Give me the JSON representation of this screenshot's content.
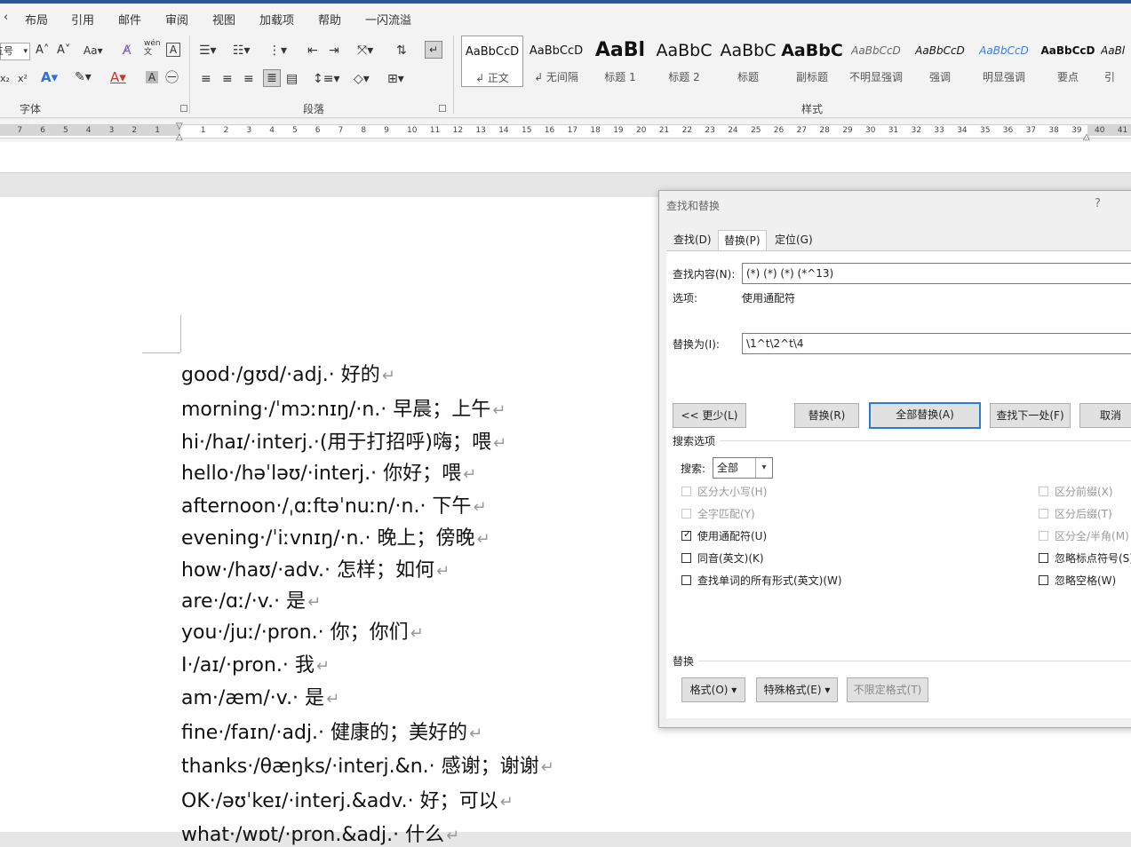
{
  "menu": [
    "布局",
    "引用",
    "邮件",
    "审阅",
    "视图",
    "加载项",
    "帮助",
    "一闪流溢"
  ],
  "ribbon": {
    "font_group_label": "字体",
    "paragraph_group_label": "段落",
    "styles_group_label": "样式",
    "font_size_partial": "五号",
    "styles": [
      {
        "preview": "AaBbCcD",
        "name": "↲ 正文"
      },
      {
        "preview": "AaBbCcD",
        "name": "↲ 无间隔"
      },
      {
        "preview": "AaBl",
        "name": "标题 1"
      },
      {
        "preview": "AaBbC",
        "name": "标题 2"
      },
      {
        "preview": "AaBbC",
        "name": "标题"
      },
      {
        "preview": "AaBbC",
        "name": "副标题"
      },
      {
        "preview": "AaBbCcD",
        "name": "不明显强调"
      },
      {
        "preview": "AaBbCcD",
        "name": "强调"
      },
      {
        "preview": "AaBbCcD",
        "name": "明显强调"
      },
      {
        "preview": "AaBbCcD",
        "name": "要点"
      },
      {
        "preview": "AaBl",
        "name": "引"
      }
    ]
  },
  "ruler": {
    "left": [
      "7",
      "6",
      "5",
      "4",
      "3",
      "2",
      "1"
    ],
    "right": [
      "1",
      "2",
      "3",
      "4",
      "5",
      "6",
      "7",
      "8",
      "9",
      "10",
      "11",
      "12",
      "13",
      "14",
      "15",
      "16",
      "17",
      "18",
      "19",
      "20",
      "21",
      "22",
      "23",
      "24",
      "25",
      "26",
      "27",
      "28",
      "29",
      "30",
      "31",
      "32",
      "33",
      "34",
      "35",
      "36",
      "37",
      "38",
      "39",
      "40",
      "41"
    ]
  },
  "document": {
    "lines": [
      "good·/gʊd/·adj.· 好的",
      "morning·/ˈmɔːnɪŋ/·n.· 早晨；上午",
      "hi·/haɪ/·interj.·(用于打招呼)嗨；喂",
      "hello·/həˈləʊ/·interj.· 你好；喂",
      "afternoon·/ˌɑːftəˈnuːn/·n.· 下午",
      "evening·/ˈiːvnɪŋ/·n.· 晚上；傍晚",
      "how·/haʊ/·adv.· 怎样；如何",
      "are·/ɑː/·v.· 是",
      "you·/juː/·pron.· 你；你们",
      "I·/aɪ/·pron.· 我",
      "am·/æm/·v.· 是",
      "fine·/faɪn/·adj.· 健康的；美好的",
      "thanks·/θæŋks/·interj.&n.· 感谢；谢谢",
      "OK·/əʊˈkeɪ/·interj.&adv.· 好；可以",
      "what·/wɒt/·pron.&adj.· 什么"
    ],
    "paragraph_mark": "↵"
  },
  "dialog": {
    "title": "查找和替换",
    "help": "?",
    "tabs": [
      "查找(D)",
      "替换(P)",
      "定位(G)"
    ],
    "find_label": "查找内容(N):",
    "find_value": "(*) (*) (*) (*^13)",
    "options_label": "选项:",
    "options_value": "使用通配符",
    "replace_label": "替换为(I):",
    "replace_value": "\\1^t\\2^t\\4",
    "btn_less": "<< 更少(L)",
    "btn_replace": "替换(R)",
    "btn_replace_all": "全部替换(A)",
    "btn_find_next": "查找下一处(F)",
    "btn_cancel": "取消",
    "search_options_label": "搜索选项",
    "search_label": "搜索:",
    "search_value": "全部",
    "left_options": [
      {
        "label": "区分大小写(H)",
        "checked": false,
        "disabled": true
      },
      {
        "label": "全字匹配(Y)",
        "checked": false,
        "disabled": true
      },
      {
        "label": "使用通配符(U)",
        "checked": true,
        "disabled": false
      },
      {
        "label": "同音(英文)(K)",
        "checked": false,
        "disabled": false
      },
      {
        "label": "查找单词的所有形式(英文)(W)",
        "checked": false,
        "disabled": false
      }
    ],
    "right_options": [
      {
        "label": "区分前缀(X)",
        "checked": false,
        "disabled": true
      },
      {
        "label": "区分后缀(T)",
        "checked": false,
        "disabled": true
      },
      {
        "label": "区分全/半角(M)",
        "checked": false,
        "disabled": true
      },
      {
        "label": "忽略标点符号(S)",
        "checked": false,
        "disabled": false
      },
      {
        "label": "忽略空格(W)",
        "checked": false,
        "disabled": false
      }
    ],
    "replace_section_label": "替换",
    "btn_format": "格式(O) ▾",
    "btn_special": "特殊格式(E) ▾",
    "btn_no_format": "不限定格式(T)"
  }
}
